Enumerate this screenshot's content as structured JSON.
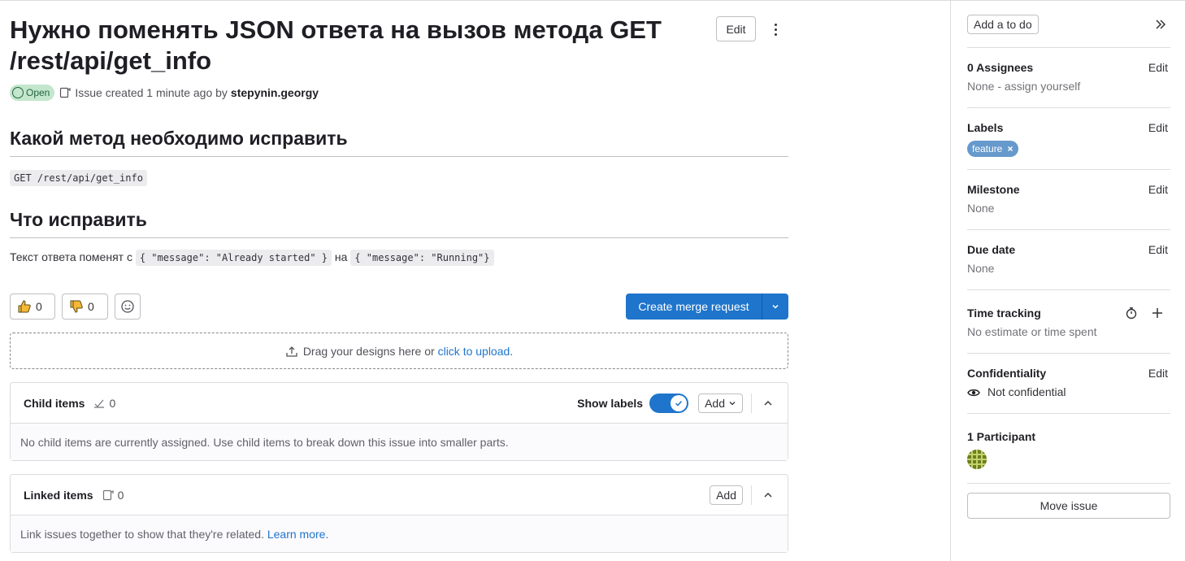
{
  "issue": {
    "title": "Нужно поменять JSON ответа на вызов метода GET /rest/api/get_info",
    "edit_label": "Edit",
    "status": "Open",
    "created_text": "Issue created 1 minute ago by",
    "author": "stepynin.georgy"
  },
  "description": {
    "heading1": "Какой метод необходимо исправить",
    "code1": "GET /rest/api/get_info",
    "heading2": "Что исправить",
    "para_text1": "Текст ответа поменят с",
    "para_code1": "{ \"message\": \"Already started\" }",
    "para_text2": "на",
    "para_code2": "{ \"message\": \"Running\"}"
  },
  "reactions": {
    "thumbs_up": "0",
    "thumbs_down": "0"
  },
  "merge_request": {
    "label": "Create merge request"
  },
  "upload": {
    "text": "Drag your designs here or",
    "link": "click to upload",
    "end": "."
  },
  "child_items": {
    "title": "Child items",
    "count": "0",
    "show_labels": "Show labels",
    "add": "Add",
    "empty": "No child items are currently assigned. Use child items to break down this issue into smaller parts."
  },
  "linked_items": {
    "title": "Linked items",
    "count": "0",
    "add": "Add",
    "empty": "Link issues together to show that they're related.",
    "learn_more": "Learn more."
  },
  "sidebar": {
    "todo": "Add a to do",
    "edit": "Edit",
    "assignees": {
      "title": "0 Assignees",
      "value": "None - assign yourself"
    },
    "labels": {
      "title": "Labels",
      "items": [
        "feature"
      ],
      "color": "#6699cc"
    },
    "milestone": {
      "title": "Milestone",
      "value": "None"
    },
    "due_date": {
      "title": "Due date",
      "value": "None"
    },
    "time_tracking": {
      "title": "Time tracking",
      "value": "No estimate or time spent"
    },
    "confidentiality": {
      "title": "Confidentiality",
      "value": "Not confidential"
    },
    "participants": {
      "title": "1 Participant"
    },
    "move_issue": "Move issue"
  },
  "colors": {
    "accent": "#1f75cb",
    "open_badge_bg": "#c3e6cd",
    "open_badge_fg": "#24663b"
  }
}
